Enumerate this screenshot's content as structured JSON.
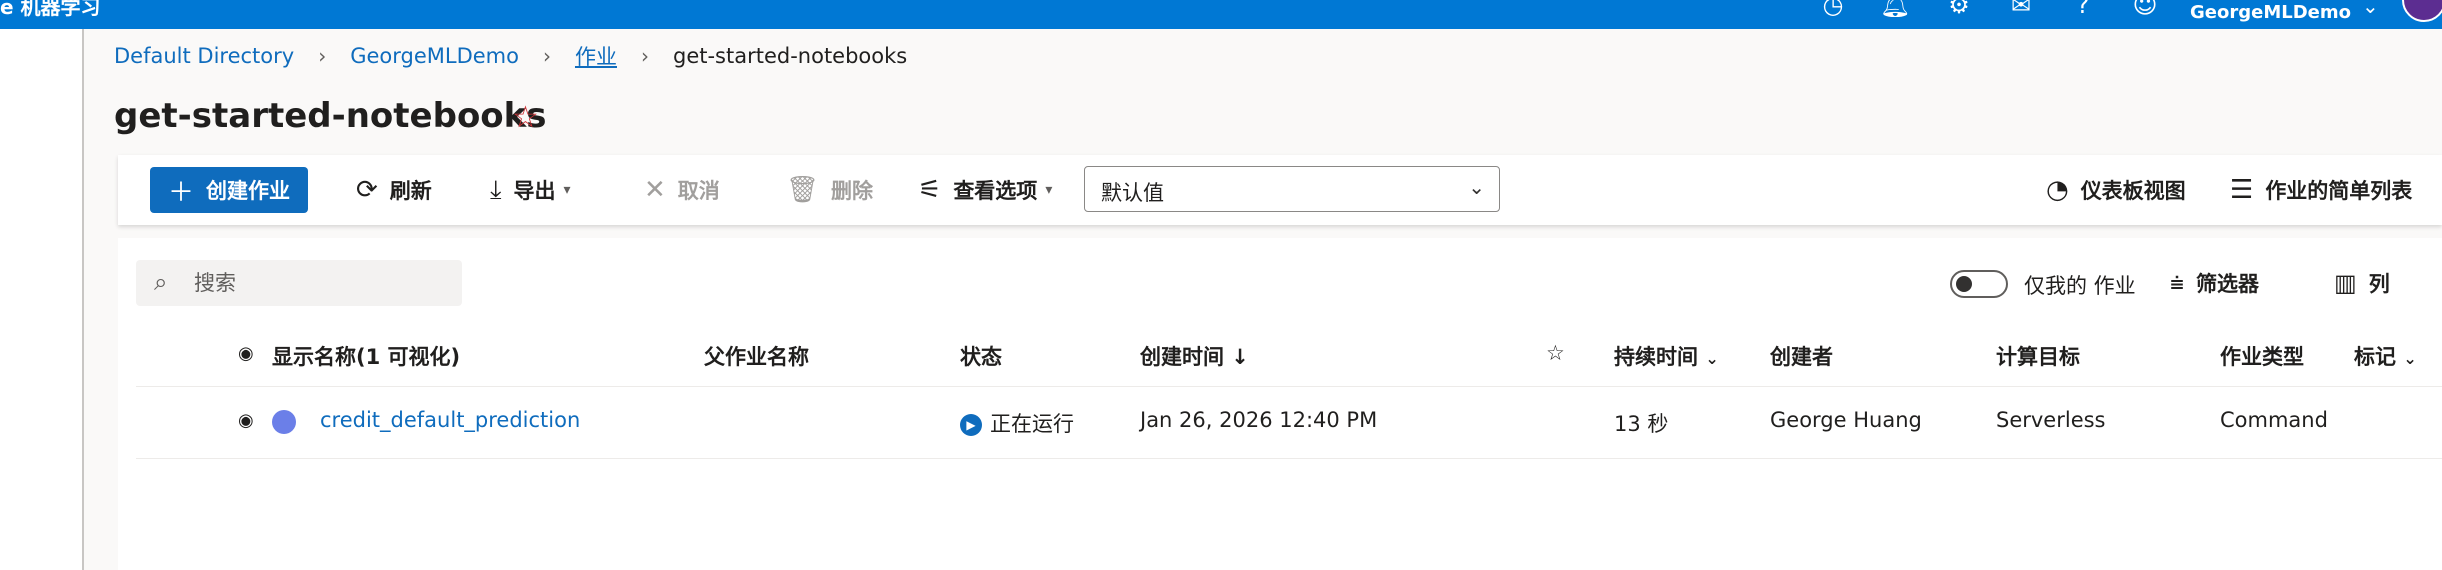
{
  "app": {
    "title": "e 机器学习",
    "user": "GeorgeMLDemo"
  },
  "breadcrumb": [
    "Default Directory",
    "GeorgeMLDemo",
    "作业",
    "get-started-notebooks"
  ],
  "page": {
    "title": "get-started-notebooks"
  },
  "toolbar": {
    "create": "创建作业",
    "refresh": "刷新",
    "export": "导出",
    "cancel": "取消",
    "delete": "删除",
    "view_options": "查看选项",
    "dropdown_value": "默认值",
    "dashboard_view": "仪表板视图",
    "simple_list": "作业的简单列表"
  },
  "filters": {
    "search_placeholder": "搜索",
    "only_mine": "仅我的 作业",
    "filter": "筛选器",
    "columns": "列"
  },
  "table": {
    "headers": {
      "display_name": "显示名称(1 可视化)",
      "parent_job": "父作业名称",
      "status": "状态",
      "created": "创建时间 ↓",
      "duration": "持续时间",
      "creator": "创建者",
      "compute": "计算目标",
      "job_type": "作业类型",
      "tags": "标记"
    },
    "rows": [
      {
        "name": "credit_default_prediction",
        "parent": "",
        "status": "正在运行",
        "created": "Jan 26, 2026 12:40 PM",
        "duration": "13 秒",
        "creator": "George Huang",
        "compute": "Serverless",
        "job_type": "Command",
        "tags": ""
      }
    ]
  },
  "colors": {
    "topbar": "#0078d4",
    "primary": "#0f6cbd",
    "star": "#d13438",
    "run_dot": "#6b7fe8"
  }
}
